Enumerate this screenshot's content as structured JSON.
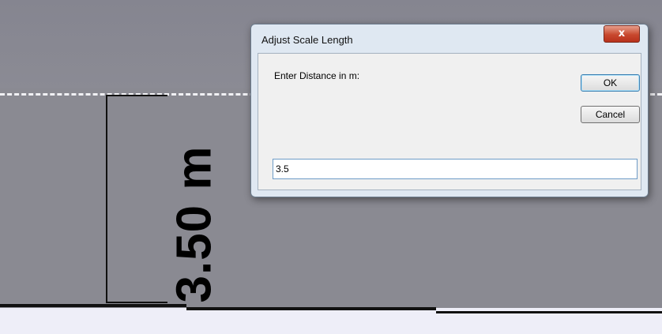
{
  "canvas": {
    "measurement_label": "3.50 m"
  },
  "dialog": {
    "title": "Adjust Scale Length",
    "close_glyph": "x",
    "prompt": "Enter Distance in m:",
    "ok_label": "OK",
    "cancel_label": "Cancel",
    "distance_value": "3.5"
  },
  "colors": {
    "canvas_gray": "#8a8a92",
    "dialog_frame": "#dfe8f2",
    "close_red": "#c8482e"
  }
}
